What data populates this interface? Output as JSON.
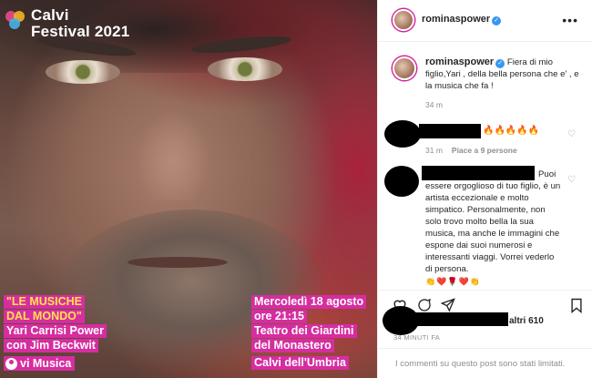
{
  "poster": {
    "logo_line1": "Calvi",
    "logo_line2": "Festival 2021",
    "left_tags": [
      "\"LE MUSICHE",
      "DAL MONDO\"",
      "Yari Carrisi Power",
      "con Jim Beckwit"
    ],
    "via_label": "vi Musica",
    "right_tags": [
      "Mercoledì 18 agosto",
      "ore 21:15",
      "Teatro dei Giardini",
      "del Monastero",
      "Calvi dell'Umbria"
    ]
  },
  "post": {
    "header_username": "rominaspower",
    "more_icon": "ellipsis-icon",
    "caption_username": "rominaspower",
    "caption_text": "Fiera di mio figlio,Yari , della bella persona che e' , e la musica che fa !",
    "caption_time": "34 m"
  },
  "comments": [
    {
      "text": "🔥🔥🔥🔥🔥",
      "time": "31 m",
      "likes": "Piace a 9 persone"
    },
    {
      "first_line": "Puoi",
      "text": "essere orgoglioso di tuo figlio, è un artista eccezionale e molto simpatico. Personalmente, non solo trovo molto bella la sua musica, ma anche le immagini che espone dai suoi numerosi e interessanti viaggi. Vorrei vederlo di persona.",
      "emojis": "👏❤️🌹❤️👏"
    }
  ],
  "actions": {
    "likes_suffix": "altri 610",
    "timestamp": "34 MINUTI FA",
    "limited_notice": "I commenti su questo post sono stati limitati."
  },
  "colors": {
    "accent": "#d62da0",
    "verified": "#3897f0",
    "muted": "#8e8e8e"
  }
}
